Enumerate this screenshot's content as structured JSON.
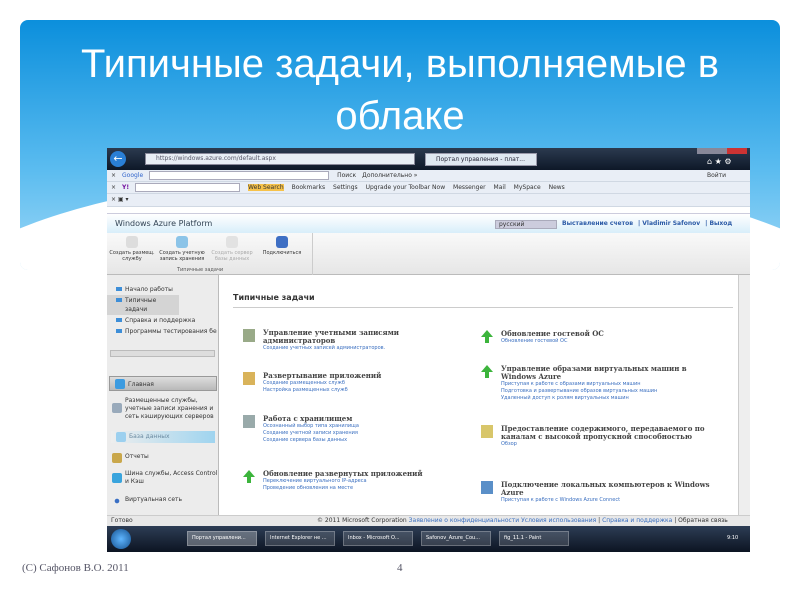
{
  "slide": {
    "title": "Типичные задачи, выполняемые в облаке",
    "footer_left": "(C) Сафонов В.О. 2011",
    "page_number": "4"
  },
  "browser": {
    "address": "https://windows.azure.com/default.aspx",
    "tab": "Портал управления - плат...",
    "google": {
      "logo": "Google",
      "search": "Поиск",
      "more": "Дополнительно »",
      "signin": "Войти"
    },
    "yahoo": {
      "logo": "Y!",
      "web_search": "Web Search",
      "bookmarks": "Bookmarks",
      "settings": "Settings",
      "upgrade": "Upgrade your Toolbar Now",
      "messenger": "Messenger",
      "mail": "Mail",
      "myspace": "MySpace",
      "news": "News"
    }
  },
  "azure": {
    "logo": "Windows Azure Platform",
    "language": "русский",
    "links": [
      "Выставление счетов",
      "Vladimir Safonov",
      "Выход"
    ],
    "ribbon": {
      "buttons": [
        "Создать размещ. службу",
        "Создать учетную запись хранения",
        "Создать сервер базы данных",
        "Подключиться"
      ],
      "group": "Типичные задачи"
    },
    "nav_tree": [
      "Начало работы",
      "Типичные задачи",
      "Справка и поддержка",
      "Программы тестирования бе"
    ],
    "nav_sections": [
      "Главная",
      "Размещенные службы, учетные записи хранения и сеть кэширующих серверов",
      "База данных",
      "Отчеты",
      "Шина службы, Access Control и Кэш",
      "Виртуальная сеть"
    ],
    "main_title": "Типичные задачи",
    "tasks_left": [
      {
        "title": "Управление учетными записями администраторов",
        "links": [
          "Создание учетных записей администраторов."
        ]
      },
      {
        "title": "Развертывание приложений",
        "links": [
          "Создание размещенных служб",
          "Настройка размещенных служб"
        ]
      },
      {
        "title": "Работа с хранилищем",
        "links": [
          "Осознанный выбор типа хранилища",
          "Создание учетной записи хранения",
          "Создание сервера базы данных"
        ]
      },
      {
        "title": "Обновление развернутых приложений",
        "links": [
          "Переключение виртуального IP-адреса",
          "Проведение обновления на месте"
        ]
      }
    ],
    "tasks_right": [
      {
        "title": "Обновление гостевой ОС",
        "links": [
          "Обновление гостевой ОС"
        ]
      },
      {
        "title": "Управление образами виртуальных машин в Windows Azure",
        "links": [
          "Приступая к работе с образами виртуальных машин",
          "Подготовка и развертывание образов виртуальных машин",
          "Удаленный доступ к ролям виртуальных машин"
        ]
      },
      {
        "title": "Предоставление содержимого, передаваемого по каналам с высокой пропускной способностью",
        "links": [
          "Обзор"
        ]
      },
      {
        "title": "Подключение локальных компьютеров к Windows Azure",
        "links": [
          "Приступая к работе с Windows Azure Connect"
        ]
      }
    ],
    "status": {
      "ready": "Готово",
      "copyright": "© 2011 Microsoft Corporation",
      "privacy": "Заявление о конфиденциальности",
      "terms": "Условия использования",
      "help": "Справка и поддержка",
      "feedback": "Обратная связь"
    }
  },
  "taskbar": {
    "items": [
      "Портал управлени...",
      "Internet Explorer не ...",
      "Inbox - Microsoft O...",
      "Safonov_Azure_Cou...",
      "fig_11.1 - Paint"
    ],
    "clock": "9:10"
  }
}
